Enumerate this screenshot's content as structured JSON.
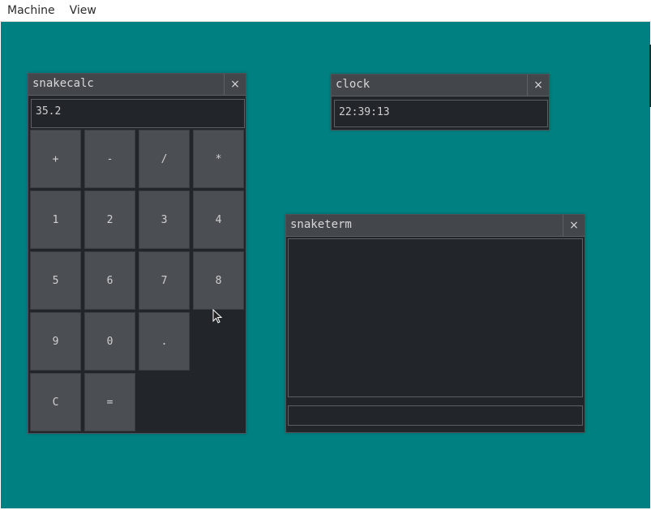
{
  "menubar": {
    "items": [
      "Machine",
      "View"
    ]
  },
  "calc": {
    "title": "snakecalc",
    "close": "×",
    "display": "35.2",
    "keys": [
      "+",
      "-",
      "/",
      "*",
      "1",
      "2",
      "3",
      "4",
      "5",
      "6",
      "7",
      "8",
      "9",
      "0",
      ".",
      "C",
      "="
    ]
  },
  "clock": {
    "title": "clock",
    "close": "×",
    "time": "22:39:13"
  },
  "term": {
    "title": "snaketerm",
    "close": "×",
    "output": "",
    "input": ""
  },
  "colors": {
    "desktop": "#008080",
    "window_bg": "#22262b",
    "titlebar": "#43474c",
    "key": "#4b4f54"
  }
}
